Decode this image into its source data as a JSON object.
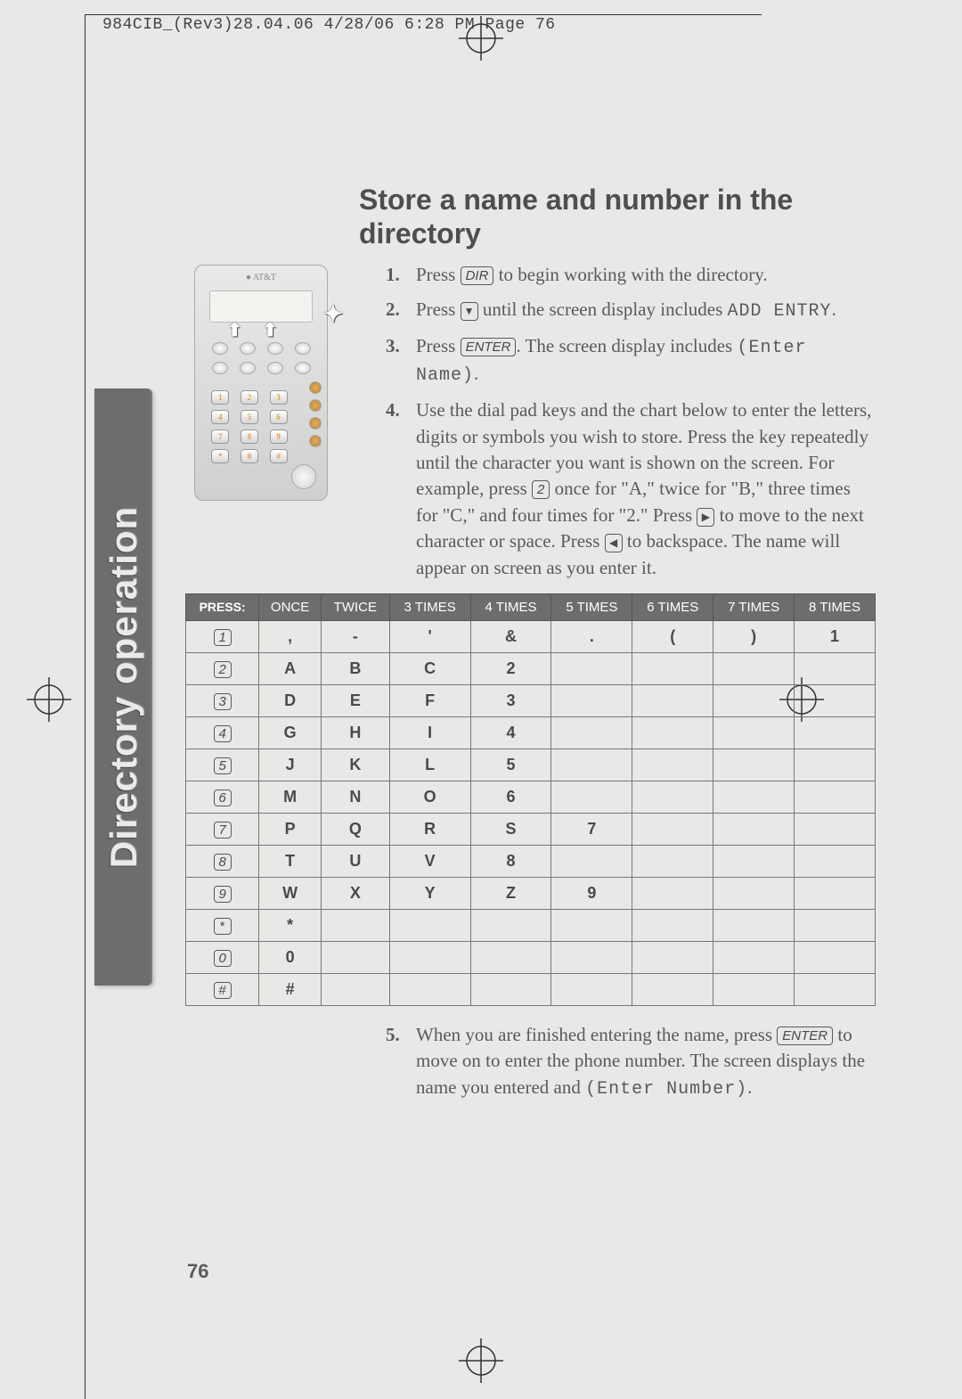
{
  "print_header": "984CIB_(Rev3)28.04.06  4/28/06  6:28 PM  Page 76",
  "sidebar_label": "Directory operation",
  "title": "Store a name and number in the directory",
  "page_number": "76",
  "steps": {
    "s1_num": "1.",
    "s1_a": "Press ",
    "s1_key": "DIR",
    "s1_b": " to begin working with the directory.",
    "s2_num": "2.",
    "s2_a": "Press ",
    "s2_sym": "▼",
    "s2_b": " until the screen display includes ",
    "s2_lcd": "ADD ENTRY",
    "s2_c": ".",
    "s3_num": "3.",
    "s3_a": "Press ",
    "s3_key": "ENTER",
    "s3_b": ".  The screen display includes ",
    "s3_lcd": "(Enter Name)",
    "s3_c": ".",
    "s4_num": "4.",
    "s4_a": "Use the dial pad keys and the chart below to enter the letters, digits or symbols you wish to store.  Press the key repeatedly until the character you want is shown on the screen.  For example, press ",
    "s4_key1": "2",
    "s4_b": " once for \"A,\" twice for \"B,\" three times for \"C,\" and four times for \"2.\"  Press ",
    "s4_sym1": "▶",
    "s4_c": " to move to the next character or space.  Press ",
    "s4_sym2": "◀",
    "s4_d": " to backspace.  The name will appear on screen as you enter it.",
    "s5_num": "5.",
    "s5_a": "When you are finished entering the name, press ",
    "s5_key": "ENTER",
    "s5_b": " to move on to enter the phone number.  The screen displays the name you entered and ",
    "s5_lcd": "(Enter Number)",
    "s5_c": "."
  },
  "chart_data": {
    "type": "table",
    "title": "Dial pad character entry chart",
    "headers": [
      "PRESS:",
      "ONCE",
      "TWICE",
      "3 TIMES",
      "4 TIMES",
      "5 TIMES",
      "6 TIMES",
      "7 TIMES",
      "8 TIMES"
    ],
    "rows": [
      {
        "key": "1",
        "cells": [
          ",",
          "-",
          "'",
          "&",
          ".",
          "(",
          ")",
          "1"
        ]
      },
      {
        "key": "2",
        "cells": [
          "A",
          "B",
          "C",
          "2",
          "",
          "",
          "",
          ""
        ]
      },
      {
        "key": "3",
        "cells": [
          "D",
          "E",
          "F",
          "3",
          "",
          "",
          "",
          ""
        ]
      },
      {
        "key": "4",
        "cells": [
          "G",
          "H",
          "I",
          "4",
          "",
          "",
          "",
          ""
        ]
      },
      {
        "key": "5",
        "cells": [
          "J",
          "K",
          "L",
          "5",
          "",
          "",
          "",
          ""
        ]
      },
      {
        "key": "6",
        "cells": [
          "M",
          "N",
          "O",
          "6",
          "",
          "",
          "",
          ""
        ]
      },
      {
        "key": "7",
        "cells": [
          "P",
          "Q",
          "R",
          "S",
          "7",
          "",
          "",
          ""
        ]
      },
      {
        "key": "8",
        "cells": [
          "T",
          "U",
          "V",
          "8",
          "",
          "",
          "",
          ""
        ]
      },
      {
        "key": "9",
        "cells": [
          "W",
          "X",
          "Y",
          "Z",
          "9",
          "",
          "",
          ""
        ]
      },
      {
        "key": "*",
        "cells": [
          "*",
          "",
          "",
          "",
          "",
          "",
          "",
          ""
        ]
      },
      {
        "key": "0",
        "cells": [
          "0",
          "",
          "",
          "",
          "",
          "",
          "",
          ""
        ]
      },
      {
        "key": "#",
        "cells": [
          "#",
          "",
          "",
          "",
          "",
          "",
          "",
          ""
        ]
      }
    ]
  }
}
